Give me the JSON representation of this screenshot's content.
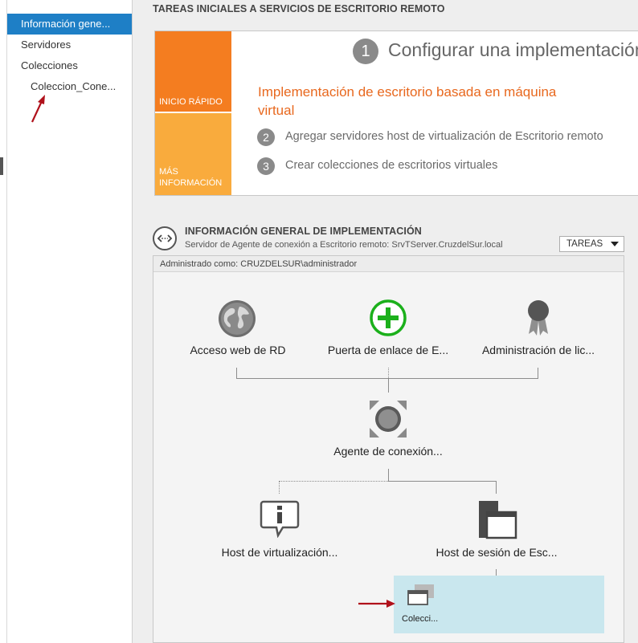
{
  "nav": {
    "items": [
      {
        "label": "Información gene...",
        "active": true
      },
      {
        "label": "Servidores"
      },
      {
        "label": "Colecciones"
      },
      {
        "label": "Coleccion_Cone...",
        "sub": true
      }
    ]
  },
  "quick_start": {
    "section_title": "TAREAS INICIALES A SERVICIOS DE ESCRITORIO REMOTO",
    "tile_quick": "INICIO RÁPIDO",
    "tile_more_line1": "MÁS",
    "tile_more_line2": "INFORMACIÓN",
    "step1_number": "1",
    "step1_title": "Configurar una implementación",
    "subtitle_line1": "Implementación de escritorio basada en máquina",
    "subtitle_line2": "virtual",
    "step2_number": "2",
    "step2_text": "Agregar servidores host de virtualización de Escritorio remoto",
    "step3_number": "3",
    "step3_text": "Crear colecciones de escritorios virtuales",
    "accent_orange": "#f47d20",
    "accent_yellow": "#f9ab3d"
  },
  "deployment": {
    "title": "INFORMACIÓN GENERAL DE IMPLEMENTACIÓN",
    "subtitle": "Servidor de Agente de conexión a Escritorio remoto: SrvTServer.CruzdelSur.local",
    "tasks_label": "TAREAS",
    "admin_text": "Administrado como: CRUZDELSUR\\administrador",
    "roles": {
      "web_access": "Acceso web de RD",
      "gateway": "Puerta de enlace de E...",
      "licensing": "Administración de lic...",
      "broker": "Agente de conexión...",
      "virtualization_host": "Host de virtualización...",
      "session_host": "Host de sesión de Esc..."
    },
    "collection_label": "Colecci...",
    "collection_bg": "#c9e7ee"
  }
}
